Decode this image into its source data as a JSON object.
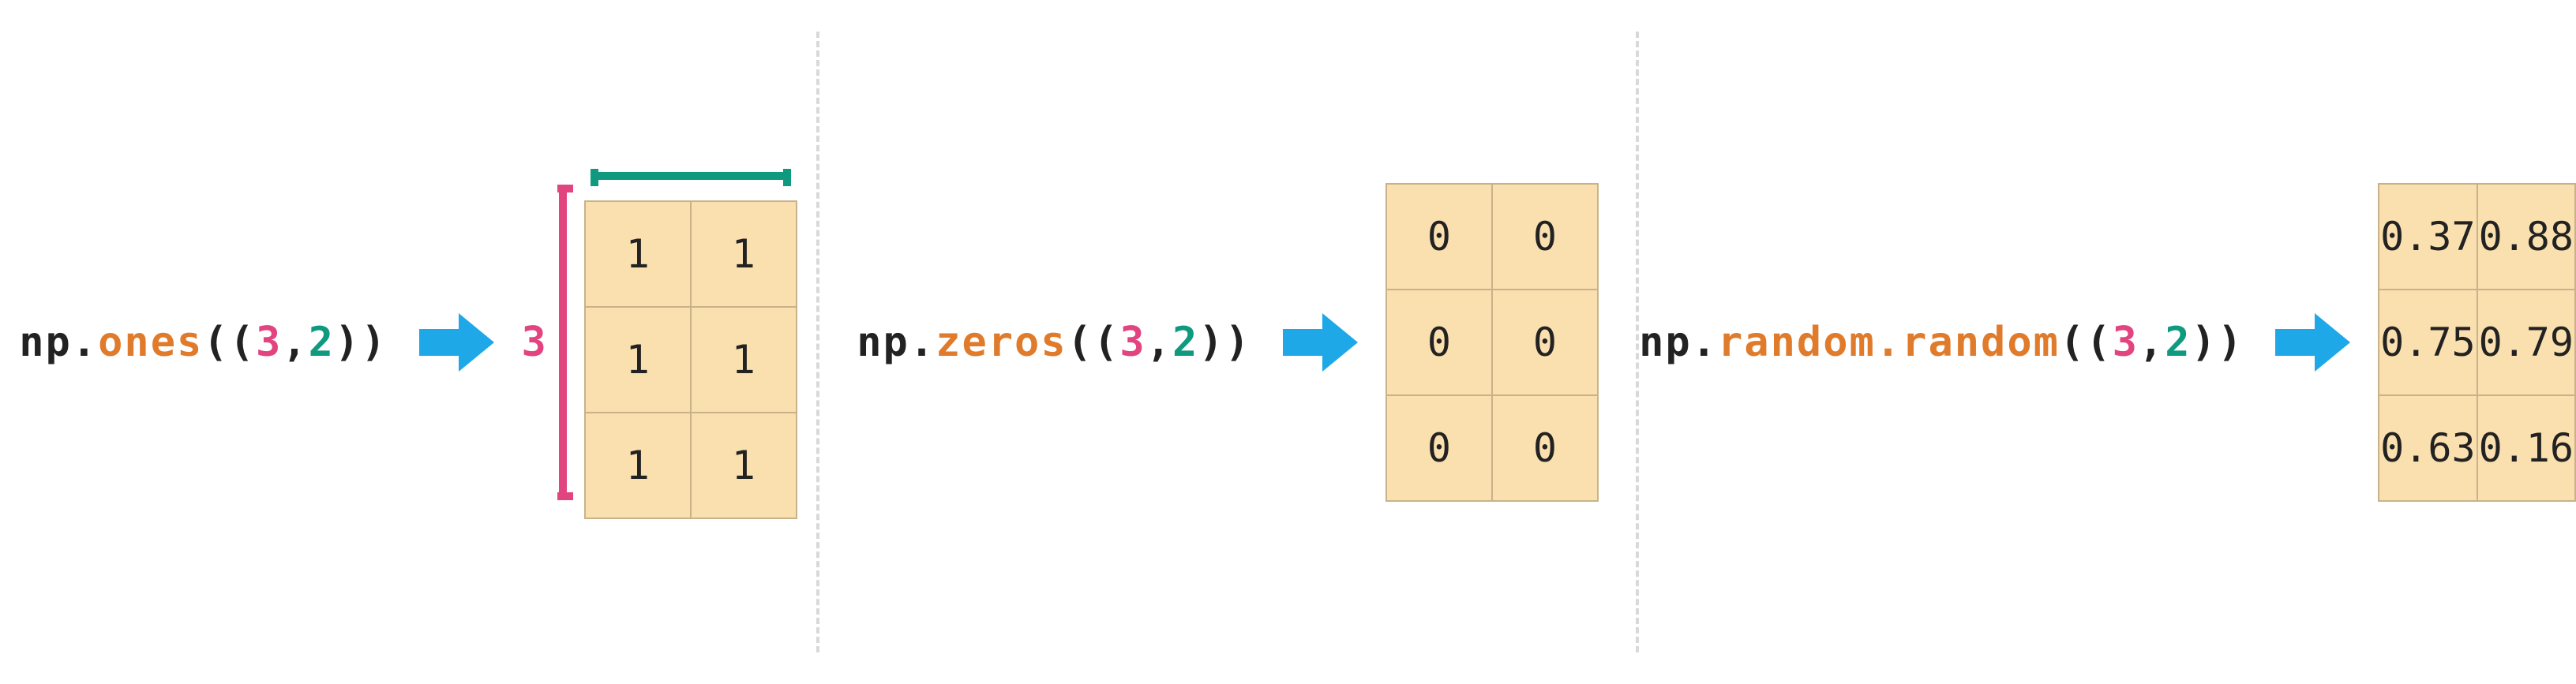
{
  "panels": [
    {
      "code": {
        "np": "np.",
        "fn": "ones",
        "rows": "3",
        "cols": "2"
      },
      "matrix": [
        [
          "1",
          "1"
        ],
        [
          "1",
          "1"
        ],
        [
          "1",
          "1"
        ]
      ],
      "show_dims": true,
      "rows_label": "3",
      "wide": false
    },
    {
      "code": {
        "np": "np.",
        "fn": "zeros",
        "rows": "3",
        "cols": "2"
      },
      "matrix": [
        [
          "0",
          "0"
        ],
        [
          "0",
          "0"
        ],
        [
          "0",
          "0"
        ]
      ],
      "show_dims": false,
      "wide": false
    },
    {
      "code": {
        "np": "np.",
        "fn": "random.random",
        "rows": "3",
        "cols": "2"
      },
      "matrix": [
        [
          "0.37",
          "0.88"
        ],
        [
          "0.75",
          "0.79"
        ],
        [
          "0.63",
          "0.16"
        ]
      ],
      "show_dims": false,
      "wide": true
    }
  ],
  "colors": {
    "arrow": "#1fa8e8",
    "rows_bracket": "#e2447f",
    "cols_bracket": "#0f9a80"
  }
}
